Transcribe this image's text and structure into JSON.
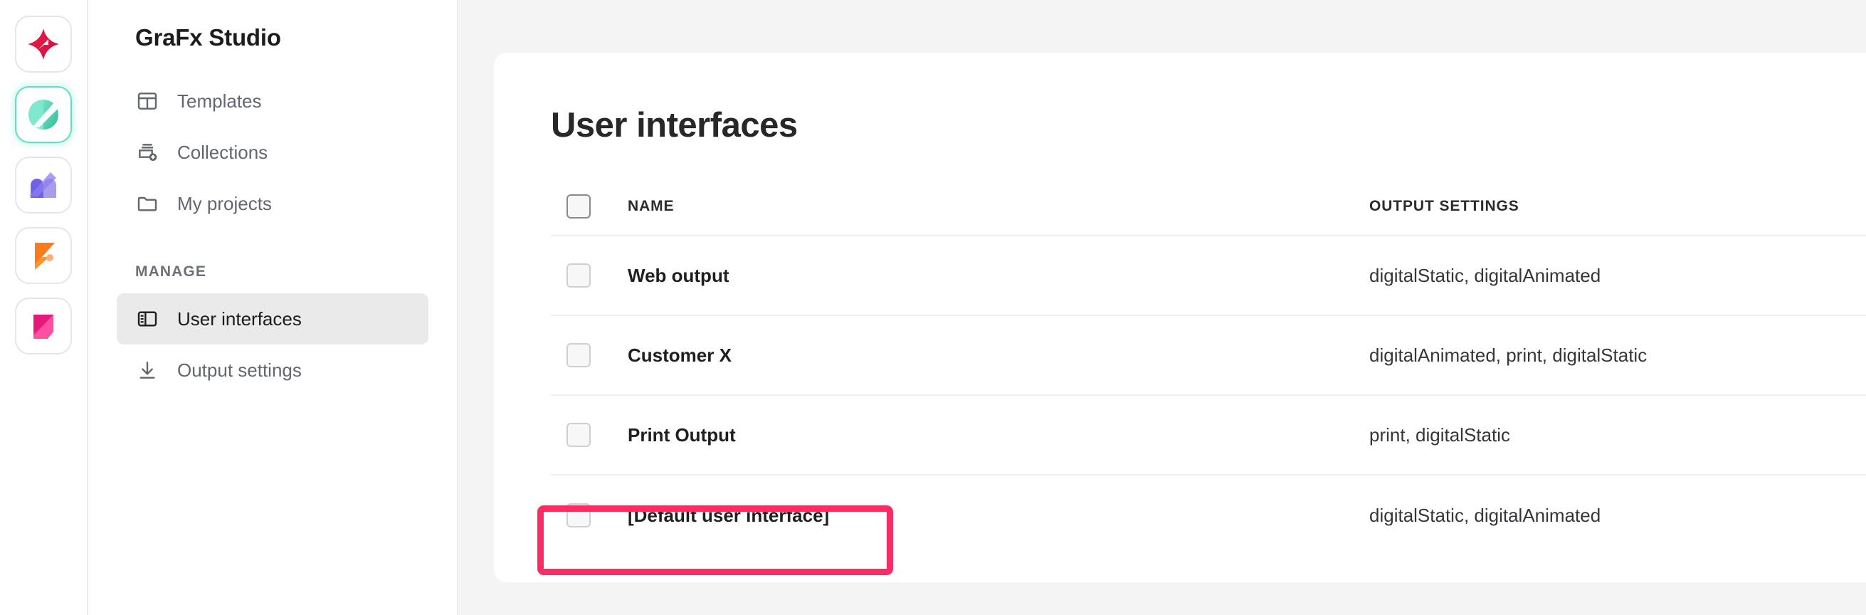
{
  "app_rail": {
    "items": [
      {
        "name": "app-icon-studio-red",
        "icon": "star-burst-icon",
        "active": false
      },
      {
        "name": "app-icon-grafx-studio",
        "icon": "leaf-s-icon",
        "active": true
      },
      {
        "name": "app-icon-purple",
        "icon": "double-arch-icon",
        "active": false
      },
      {
        "name": "app-icon-orange",
        "icon": "flag-f-icon",
        "active": false
      },
      {
        "name": "app-icon-pink",
        "icon": "folded-square-icon",
        "active": false
      }
    ]
  },
  "sidebar": {
    "title": "GraFx Studio",
    "items": [
      {
        "label": "Templates",
        "icon": "layout-template-icon",
        "selected": false
      },
      {
        "label": "Collections",
        "icon": "collections-add-icon",
        "selected": false
      },
      {
        "label": "My projects",
        "icon": "folder-icon",
        "selected": false
      }
    ],
    "section_title": "MANAGE",
    "manage_items": [
      {
        "label": "User interfaces",
        "icon": "panel-layout-icon",
        "selected": true
      },
      {
        "label": "Output settings",
        "icon": "download-icon",
        "selected": false
      }
    ]
  },
  "main": {
    "page_title": "User interfaces",
    "table": {
      "columns": [
        "NAME",
        "OUTPUT SETTINGS"
      ],
      "rows": [
        {
          "name": "Web output",
          "output_settings": "digitalStatic, digitalAnimated"
        },
        {
          "name": "Customer X",
          "output_settings": "digitalAnimated, print, digitalStatic"
        },
        {
          "name": "Print Output",
          "output_settings": "print, digitalStatic"
        },
        {
          "name": "[Default user interface]",
          "output_settings": "digitalStatic, digitalAnimated"
        }
      ]
    }
  },
  "annotation": {
    "highlight_color": "#fb2b63",
    "highlight_target": "[Default user interface]"
  },
  "colors": {
    "accent_teal": "#5ee0c3",
    "highlight_pink": "#fb2b63",
    "canvas_bg": "#f4f4f4",
    "card_bg": "#ffffff",
    "selected_nav_bg": "#eaeaea"
  }
}
